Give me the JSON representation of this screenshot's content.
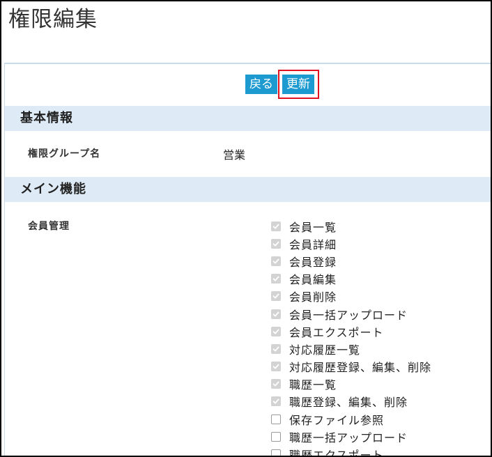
{
  "page": {
    "title": "権限編集"
  },
  "toolbar": {
    "back_label": "戻る",
    "update_label": "更新"
  },
  "colors": {
    "button_bg": "#1d9bd1",
    "section_bg": "#deeaf6",
    "highlight": "#e0141e"
  },
  "sections": {
    "basic": {
      "title": "基本情報",
      "group_name_label": "権限グループ名",
      "group_name_value": "営業"
    },
    "main": {
      "title": "メイン機能",
      "member_label": "会員管理",
      "permissions": [
        {
          "label": "会員一覧",
          "checked": true
        },
        {
          "label": "会員詳細",
          "checked": true
        },
        {
          "label": "会員登録",
          "checked": true
        },
        {
          "label": "会員編集",
          "checked": true
        },
        {
          "label": "会員削除",
          "checked": true
        },
        {
          "label": "会員一括アップロード",
          "checked": true
        },
        {
          "label": "会員エクスポート",
          "checked": true
        },
        {
          "label": "対応履歴一覧",
          "checked": true
        },
        {
          "label": "対応履歴登録、編集、削除",
          "checked": true
        },
        {
          "label": "職歴一覧",
          "checked": true
        },
        {
          "label": "職歴登録、編集、削除",
          "checked": true
        },
        {
          "label": "保存ファイル参照",
          "checked": false
        },
        {
          "label": "職歴一括アップロード",
          "checked": false
        },
        {
          "label": "職歴エクスポート",
          "checked": false
        }
      ]
    }
  }
}
